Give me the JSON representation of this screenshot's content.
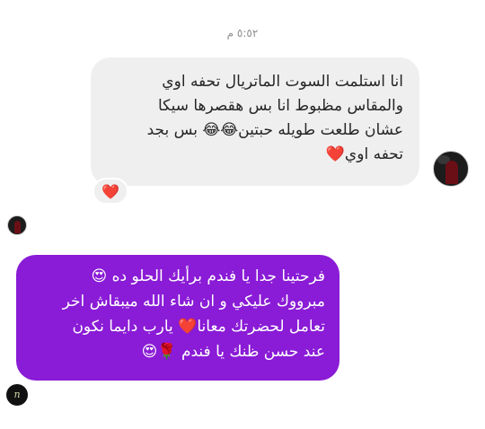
{
  "timestamp": "٥:٥٢ م",
  "received_message": {
    "lines": [
      "انا استلمت السوت الماتريال تحفه اوي",
      "والمقاس مظبوط انا بس هقصرها سيكا",
      "عشان طلعت طويله حبتين😂😂 بس بجد",
      "تحفه اوي❤️"
    ],
    "reaction": "❤️"
  },
  "sent_message": {
    "lines": [
      "فرحتينا جدا يا فندم برأيك الحلو ده 😍",
      "مبرووك عليكي و ان شاء الله ميبقاش اخر",
      "تعامل لحضرتك معانا❤️ يارب دايما نكون",
      "عند حسن ظنك يا فندم 🌹😍"
    ]
  },
  "brand_mark": "n",
  "colors": {
    "received_bubble": "#efefef",
    "sent_bubble": "#8a1bd6",
    "reaction_heart": "#e0182d"
  }
}
